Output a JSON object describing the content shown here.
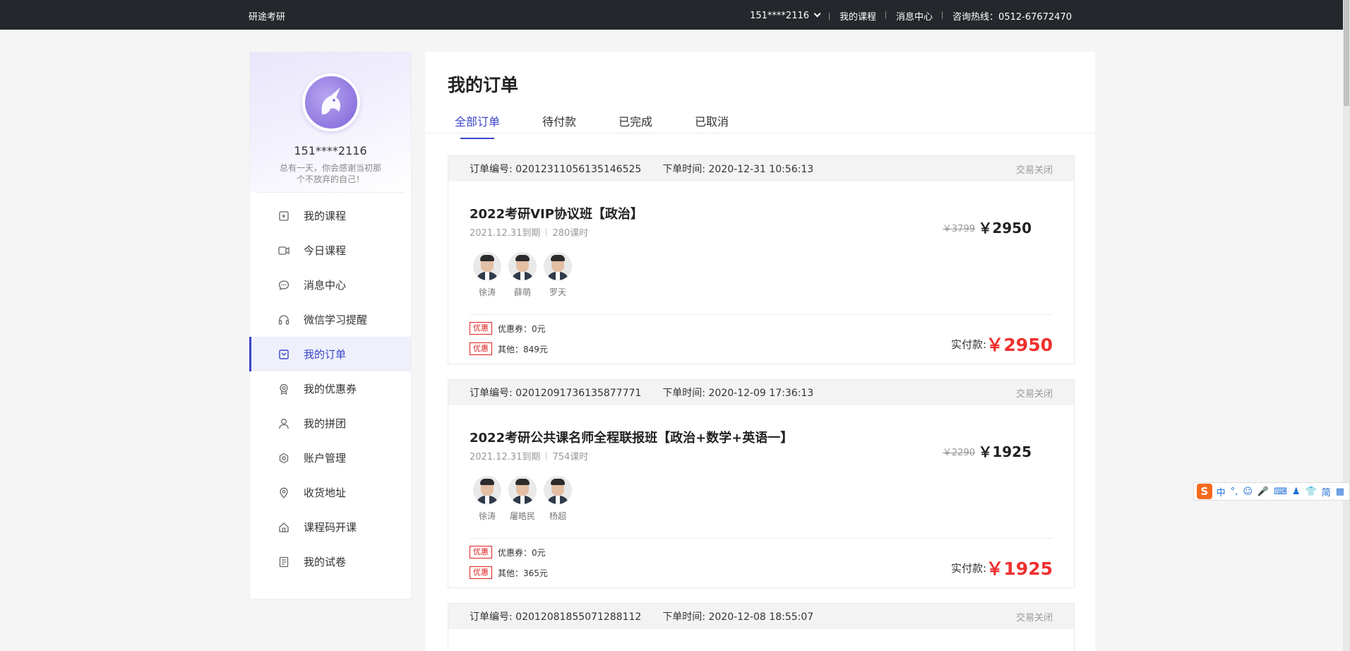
{
  "topbar": {
    "brand": "研途考研",
    "user": "151****2116",
    "my_courses": "我的课程",
    "messages": "消息中心",
    "hotline": "咨询热线：0512-67672470"
  },
  "sidebar": {
    "username": "151****2116",
    "motto": "总有一天，你会感谢当初那个不放弃的自己！",
    "items": [
      {
        "label": "我的课程",
        "icon": "play-box-icon"
      },
      {
        "label": "今日课程",
        "icon": "video-icon"
      },
      {
        "label": "消息中心",
        "icon": "chat-icon"
      },
      {
        "label": "微信学习提醒",
        "icon": "headphones-icon"
      },
      {
        "label": "我的订单",
        "icon": "order-icon",
        "active": true
      },
      {
        "label": "我的优惠券",
        "icon": "coupon-icon"
      },
      {
        "label": "我的拼团",
        "icon": "group-icon"
      },
      {
        "label": "账户管理",
        "icon": "account-icon"
      },
      {
        "label": "收货地址",
        "icon": "location-icon"
      },
      {
        "label": "课程码开课",
        "icon": "home-icon"
      },
      {
        "label": "我的试卷",
        "icon": "paper-icon"
      }
    ]
  },
  "main": {
    "title": "我的订单",
    "tabs": [
      "全部订单",
      "待付款",
      "已完成",
      "已取消"
    ],
    "orders": [
      {
        "order_no": "订单编号: 02012311056135146525",
        "time": "下单时间: 2020-12-31 10:56:13",
        "status": "交易关闭",
        "course": "2022考研VIP协议班【政治】",
        "expire": "2021.12.31到期",
        "hours": "280课时",
        "teachers": [
          "徐涛",
          "薛萌",
          "罗天"
        ],
        "old_price": "￥3799",
        "price": "￥2950",
        "tag": "优惠",
        "coupon": "优惠券：0元",
        "other": "其他：849元",
        "paid_label": "实付款:",
        "paid": "￥2950"
      },
      {
        "order_no": "订单编号: 02012091736135877771",
        "time": "下单时间: 2020-12-09 17:36:13",
        "status": "交易关闭",
        "course": "2022考研公共课名师全程联报班【政治+数学+英语一】",
        "expire": "2021.12.31到期",
        "hours": "754课时",
        "teachers": [
          "徐涛",
          "屠皓民",
          "杨超"
        ],
        "old_price": "￥2290",
        "price": "￥1925",
        "tag": "优惠",
        "coupon": "优惠券：0元",
        "other": "其他：365元",
        "paid_label": "实付款:",
        "paid": "￥1925"
      },
      {
        "order_no": "订单编号: 02012081855071288112",
        "time": "下单时间: 2020-12-08 18:55:07",
        "status": "交易关闭"
      }
    ]
  },
  "ime": {
    "logo": "S",
    "items": [
      "中",
      "°,",
      "☺",
      "🎤",
      "⌨",
      "♟",
      "👕",
      "简",
      "▦"
    ]
  }
}
